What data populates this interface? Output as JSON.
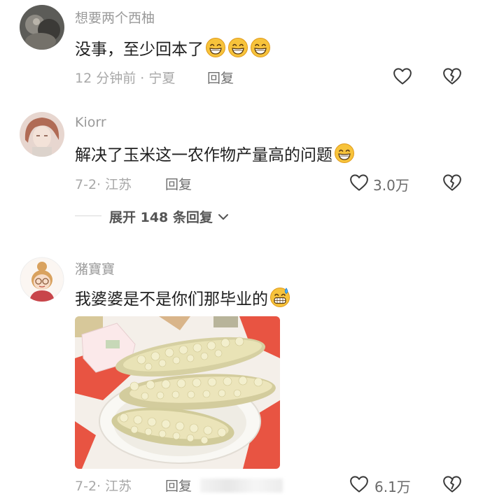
{
  "comments": [
    {
      "username": "想要两个西柚",
      "text": "没事，至少回本了",
      "time": "12 分钟前",
      "location": "宁夏",
      "reply_label": "回复",
      "like_count": "",
      "emoji": [
        "grin-emoji",
        "grin-emoji",
        "grin-emoji"
      ]
    },
    {
      "username": "Kiorr",
      "text": "解决了玉米这一农作物产量高的问题",
      "time": "7-2",
      "location": "江苏",
      "reply_label": "回复",
      "like_count": "3.0万",
      "emoji": [
        "grin-emoji"
      ]
    },
    {
      "username": "潴寶寶",
      "text": "我婆婆是不是你们那毕业的",
      "time": "7-2",
      "location": "江苏",
      "reply_label": "回复",
      "like_count": "6.1万",
      "emoji": [
        "sweat-grin-emoji"
      ]
    }
  ],
  "expand_replies": "展开 148 条回复",
  "icons": {
    "like": "heart-outline-icon",
    "dislike": "broken-heart-icon",
    "expand": "chevron-down-icon"
  },
  "colors": {
    "username": "#9a9a9a",
    "text": "#1f1f1f",
    "meta": "#a8a8a8",
    "emoji": "#f5b731"
  }
}
